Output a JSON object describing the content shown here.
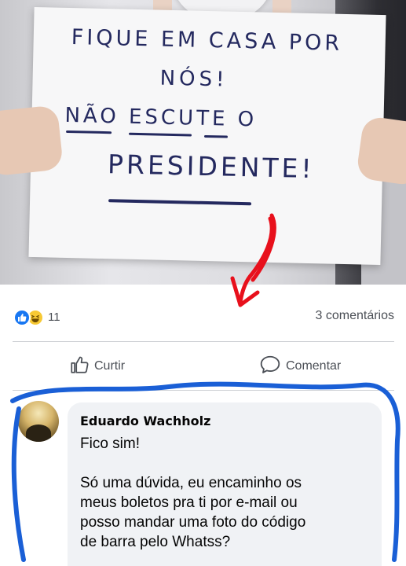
{
  "photo": {
    "sign": {
      "line1": "FIQUE EM CASA POR",
      "line2": "NÓS!",
      "line3": "NÃO ESCUTE O",
      "line4": "PRESIDENTE!"
    }
  },
  "post": {
    "reactions": {
      "icons": [
        "like-icon",
        "haha-icon"
      ],
      "count": "11"
    },
    "comments_count": "3 comentários",
    "actions": {
      "like_label": "Curtir",
      "comment_label": "Comentar"
    }
  },
  "comment": {
    "author": "Eduardo Wachholz",
    "line1": "Fico sim!",
    "line2": "Só uma dúvida, eu encaminho os",
    "line3": "meus boletos pra ti por e-mail ou",
    "line4": "posso mandar uma foto do código",
    "line5": "de barra pelo Whatss?"
  },
  "annotations": {
    "arrow_color": "#e8101c",
    "highlight_color": "#1a5fd6"
  },
  "colors": {
    "facebook_blue": "#1877f2",
    "text_secondary": "#4b4f56",
    "bubble_bg": "#f0f2f5"
  }
}
